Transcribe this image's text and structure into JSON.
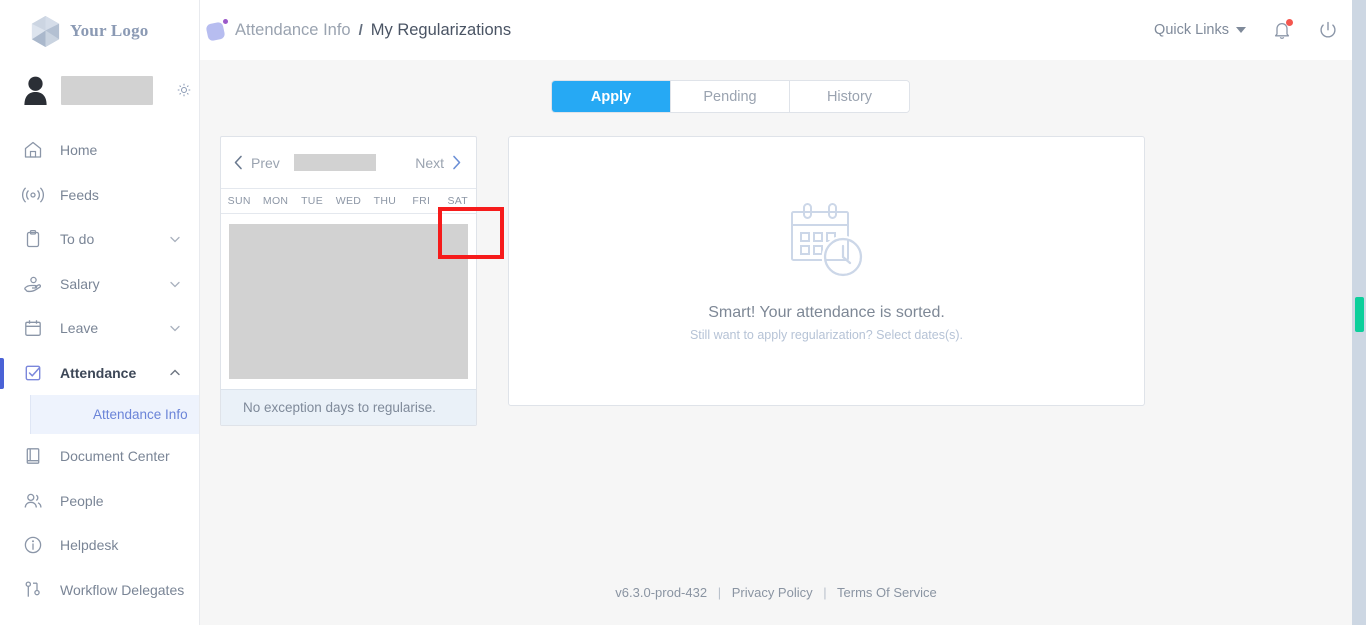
{
  "brand": {
    "logo_text": "Your Logo",
    "logo_icon": "gem-hexagon-icon"
  },
  "profile": {
    "avatar_icon": "person-avatar-icon",
    "name": "",
    "settings_icon": "gear-icon"
  },
  "sidebar": {
    "items": [
      {
        "label": "Home",
        "icon": "home-icon",
        "expandable": false,
        "active": false
      },
      {
        "label": "Feeds",
        "icon": "rss-broadcast-icon",
        "expandable": false,
        "active": false
      },
      {
        "label": "To do",
        "icon": "clipboard-icon",
        "expandable": true,
        "active": false
      },
      {
        "label": "Salary",
        "icon": "hand-coin-icon",
        "expandable": true,
        "active": false
      },
      {
        "label": "Leave",
        "icon": "calendar-icon",
        "expandable": true,
        "active": false
      },
      {
        "label": "Attendance",
        "icon": "checkbox-check-icon",
        "expandable": true,
        "active": true
      }
    ],
    "sub_item": {
      "label": "Attendance Info",
      "active": true
    },
    "items_after": [
      {
        "label": "Document Center",
        "icon": "book-icon",
        "expandable": false,
        "active": false
      },
      {
        "label": "People",
        "icon": "people-icon",
        "expandable": false,
        "active": false
      },
      {
        "label": "Helpdesk",
        "icon": "info-circle-icon",
        "expandable": false,
        "active": false
      },
      {
        "label": "Workflow Delegates",
        "icon": "workflow-nodes-icon",
        "expandable": false,
        "active": false
      }
    ]
  },
  "header": {
    "breadcrumb_parent": "Attendance Info",
    "breadcrumb_separator": "/",
    "breadcrumb_current": "My Regularizations",
    "quick_links": "Quick Links",
    "notifications_icon": "bell-icon",
    "power_icon": "power-icon",
    "has_notification_dot": true
  },
  "tabs": [
    {
      "label": "Apply",
      "active": true
    },
    {
      "label": "Pending",
      "active": false
    },
    {
      "label": "History",
      "active": false
    }
  ],
  "calendar": {
    "prev_label": "Prev",
    "next_label": "Next",
    "month_value": "",
    "weekdays": [
      "SUN",
      "MON",
      "TUE",
      "WED",
      "THU",
      "FRI",
      "SAT"
    ],
    "footer_note": "No exception days to regularise.",
    "highlight_target": "next-button"
  },
  "empty_state": {
    "illustration": "calendar-clock-icon",
    "title": "Smart! Your attendance is sorted.",
    "subtitle": "Still want to apply regularization? Select dates(s)."
  },
  "footer": {
    "version": "v6.3.0-prod-432",
    "separator": "|",
    "privacy": "Privacy Policy",
    "terms": "Terms Of Service"
  },
  "colors": {
    "accent_blue": "#26a9f4",
    "active_bar": "#4a62d6",
    "highlight_red": "#f61b1b",
    "scroll_green": "#0ccf9b",
    "notification_red": "#f4564e"
  }
}
